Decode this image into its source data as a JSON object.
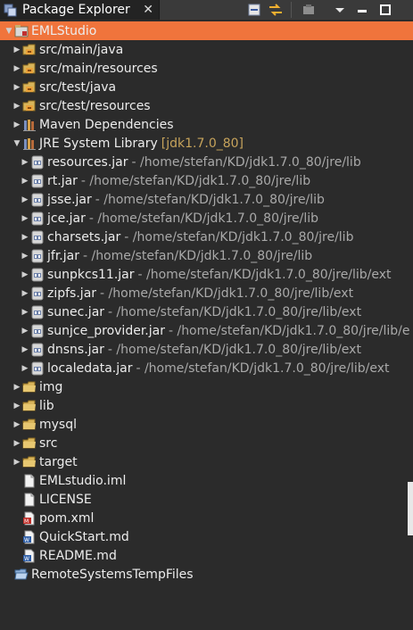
{
  "tab": {
    "title": "Package Explorer",
    "close": "✕"
  },
  "toolbar": [
    {
      "name": "collapse-all-icon"
    },
    {
      "name": "link-with-editor-icon"
    },
    {
      "name": "focus-icon"
    },
    {
      "name": "view-menu-icon"
    },
    {
      "name": "minimize-icon"
    },
    {
      "name": "maximize-icon"
    }
  ],
  "colors": {
    "selection": "#f0743c",
    "background": "#2b2b2b",
    "path": "#a9a9a9",
    "version": "#c6a35b"
  },
  "tree": [
    {
      "label": "EMLStudio",
      "icon": "project-icon",
      "indent": 0,
      "arrow": "expanded",
      "selected": true
    },
    {
      "label": "src/main/java",
      "icon": "source-folder-icon",
      "indent": 1,
      "arrow": "collapsed"
    },
    {
      "label": "src/main/resources",
      "icon": "source-folder-icon",
      "indent": 1,
      "arrow": "collapsed"
    },
    {
      "label": "src/test/java",
      "icon": "source-folder-icon",
      "indent": 1,
      "arrow": "collapsed"
    },
    {
      "label": "src/test/resources",
      "icon": "source-folder-icon",
      "indent": 1,
      "arrow": "collapsed"
    },
    {
      "label": "Maven Dependencies",
      "icon": "library-icon",
      "indent": 1,
      "arrow": "collapsed"
    },
    {
      "label": "JRE System Library",
      "version": "[jdk1.7.0_80]",
      "icon": "library-icon",
      "indent": 1,
      "arrow": "expanded"
    },
    {
      "label": "resources.jar",
      "path": "- /home/stefan/KD/jdk1.7.0_80/jre/lib",
      "icon": "jar-icon",
      "indent": 2,
      "arrow": "collapsed"
    },
    {
      "label": "rt.jar",
      "path": "- /home/stefan/KD/jdk1.7.0_80/jre/lib",
      "icon": "jar-icon",
      "indent": 2,
      "arrow": "collapsed"
    },
    {
      "label": "jsse.jar",
      "path": "- /home/stefan/KD/jdk1.7.0_80/jre/lib",
      "icon": "jar-icon",
      "indent": 2,
      "arrow": "collapsed"
    },
    {
      "label": "jce.jar",
      "path": "- /home/stefan/KD/jdk1.7.0_80/jre/lib",
      "icon": "jar-icon",
      "indent": 2,
      "arrow": "collapsed"
    },
    {
      "label": "charsets.jar",
      "path": "- /home/stefan/KD/jdk1.7.0_80/jre/lib",
      "icon": "jar-icon",
      "indent": 2,
      "arrow": "collapsed"
    },
    {
      "label": "jfr.jar",
      "path": "- /home/stefan/KD/jdk1.7.0_80/jre/lib",
      "icon": "jar-icon",
      "indent": 2,
      "arrow": "collapsed"
    },
    {
      "label": "sunpkcs11.jar",
      "path": "- /home/stefan/KD/jdk1.7.0_80/jre/lib/ext",
      "icon": "jar-icon",
      "indent": 2,
      "arrow": "collapsed"
    },
    {
      "label": "zipfs.jar",
      "path": "- /home/stefan/KD/jdk1.7.0_80/jre/lib/ext",
      "icon": "jar-icon",
      "indent": 2,
      "arrow": "collapsed"
    },
    {
      "label": "sunec.jar",
      "path": "- /home/stefan/KD/jdk1.7.0_80/jre/lib/ext",
      "icon": "jar-icon",
      "indent": 2,
      "arrow": "collapsed"
    },
    {
      "label": "sunjce_provider.jar",
      "path": "- /home/stefan/KD/jdk1.7.0_80/jre/lib/e",
      "icon": "jar-icon",
      "indent": 2,
      "arrow": "collapsed"
    },
    {
      "label": "dnsns.jar",
      "path": "- /home/stefan/KD/jdk1.7.0_80/jre/lib/ext",
      "icon": "jar-icon",
      "indent": 2,
      "arrow": "collapsed"
    },
    {
      "label": "localedata.jar",
      "path": "- /home/stefan/KD/jdk1.7.0_80/jre/lib/ext",
      "icon": "jar-icon",
      "indent": 2,
      "arrow": "collapsed"
    },
    {
      "label": "img",
      "icon": "folder-icon",
      "indent": 1,
      "arrow": "collapsed"
    },
    {
      "label": "lib",
      "icon": "folder-icon",
      "indent": 1,
      "arrow": "collapsed"
    },
    {
      "label": "mysql",
      "icon": "folder-icon",
      "indent": 1,
      "arrow": "collapsed"
    },
    {
      "label": "src",
      "icon": "folder-icon",
      "indent": 1,
      "arrow": "collapsed"
    },
    {
      "label": "target",
      "icon": "folder-icon",
      "indent": 1,
      "arrow": "collapsed"
    },
    {
      "label": "EMLstudio.iml",
      "icon": "file-icon",
      "indent": 1,
      "arrow": "none"
    },
    {
      "label": "LICENSE",
      "icon": "file-icon",
      "indent": 1,
      "arrow": "none"
    },
    {
      "label": "pom.xml",
      "icon": "xml-file-icon",
      "indent": 1,
      "arrow": "none"
    },
    {
      "label": "QuickStart.md",
      "icon": "doc-file-icon",
      "indent": 1,
      "arrow": "none"
    },
    {
      "label": "README.md",
      "icon": "doc-file-icon",
      "indent": 1,
      "arrow": "none"
    },
    {
      "label": "RemoteSystemsTempFiles",
      "icon": "open-folder-icon",
      "indent": 0,
      "arrow": "none"
    }
  ]
}
